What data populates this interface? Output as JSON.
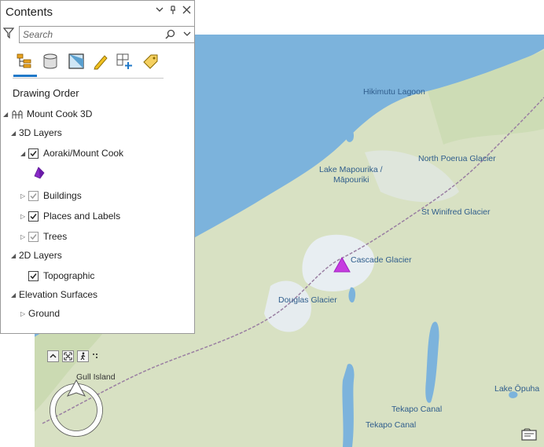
{
  "contents_pane": {
    "title": "Contents",
    "search_placeholder": "Search",
    "drawing_order_label": "Drawing Order",
    "scene_name": "Mount Cook 3D",
    "groups": {
      "layers_3d": "3D Layers",
      "aoraki": "Aoraki/Mount Cook",
      "buildings": "Buildings",
      "places": "Places and Labels",
      "trees": "Trees",
      "layers_2d": "2D Layers",
      "topographic": "Topographic",
      "elevation": "Elevation Surfaces",
      "ground": "Ground"
    },
    "toolbar_icons": [
      "list-by-drawing-order-icon",
      "list-by-data-source-icon",
      "list-by-selection-icon",
      "list-by-editing-icon",
      "list-by-snapping-icon",
      "list-by-labeling-icon"
    ],
    "colors": {
      "accent": "#1f78c8",
      "symbol": "#8a2ac8"
    }
  },
  "map": {
    "labels": {
      "hikimutu": "Hikimutu Lagoon",
      "north_poerua": "North Poerua Glacier",
      "lake_mapourika": "Lake Mapourika /",
      "mapouriki": "Māpouriki",
      "st_winifred": "St Winifred Glacier",
      "cascade": "Cascade Glacier",
      "douglas": "Douglas Glacier",
      "gull_island": "Gull Island",
      "lake_ohau": "Lake Ōpuha",
      "tekapo1": "Tekapo Canal",
      "tekapo2": "Tekapo Canal"
    },
    "colors": {
      "sea": "#7db4dd",
      "land": "#d9e2c4",
      "marker": "#c63ce0",
      "trail": "#9a7fa2"
    }
  }
}
